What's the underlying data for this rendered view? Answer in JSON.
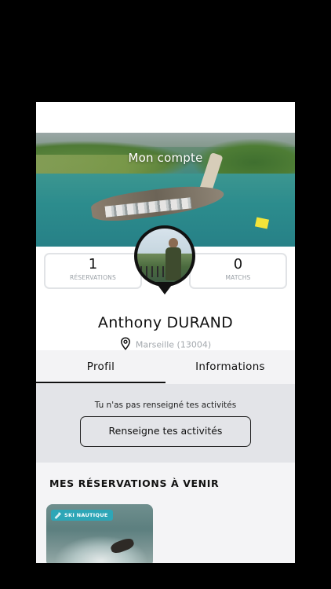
{
  "header": {
    "title": "Mon compte"
  },
  "stats": {
    "reservations": {
      "value": "1",
      "label": "RÉSERVATIONS"
    },
    "matchs": {
      "value": "0",
      "label": "MATCHS"
    }
  },
  "profile": {
    "first_name": "Anthony",
    "last_name": "DURAND",
    "location": "Marseille (13004)",
    "location_icon": "location-pin-icon"
  },
  "tabs": [
    {
      "label": "Profil",
      "active": true
    },
    {
      "label": "Informations",
      "active": false
    }
  ],
  "activities": {
    "message": "Tu n'as pas renseigné tes activités",
    "button_label": "Renseigne tes activités"
  },
  "upcoming": {
    "heading": "MES RÉSERVATIONS À VENIR",
    "cards": [
      {
        "tag": "SKI NAUTIQUE",
        "tag_icon": "water-ski-icon",
        "tag_color": "#2ea6b7"
      }
    ]
  }
}
